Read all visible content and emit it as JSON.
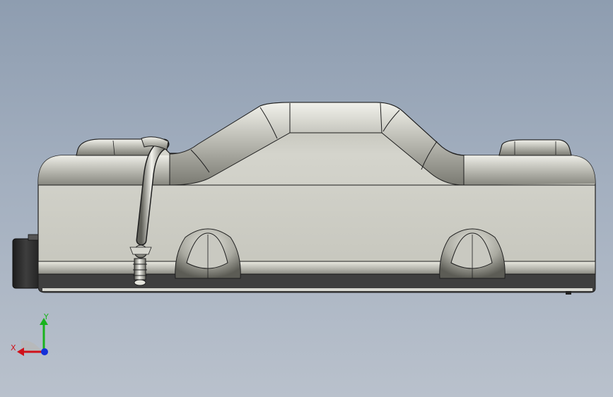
{
  "viewport": {
    "background_top": "#8e9db0",
    "background_bottom": "#b9c1cc"
  },
  "model": {
    "body_color": "#cfcfc6",
    "shadow_color": "#4a4a4a",
    "edge_color": "#1e1e1e"
  },
  "triad": {
    "x_label": "X",
    "y_label": "Y",
    "x_color": "#d0111a",
    "y_color": "#19b31d",
    "z_color": "#1530d8"
  }
}
